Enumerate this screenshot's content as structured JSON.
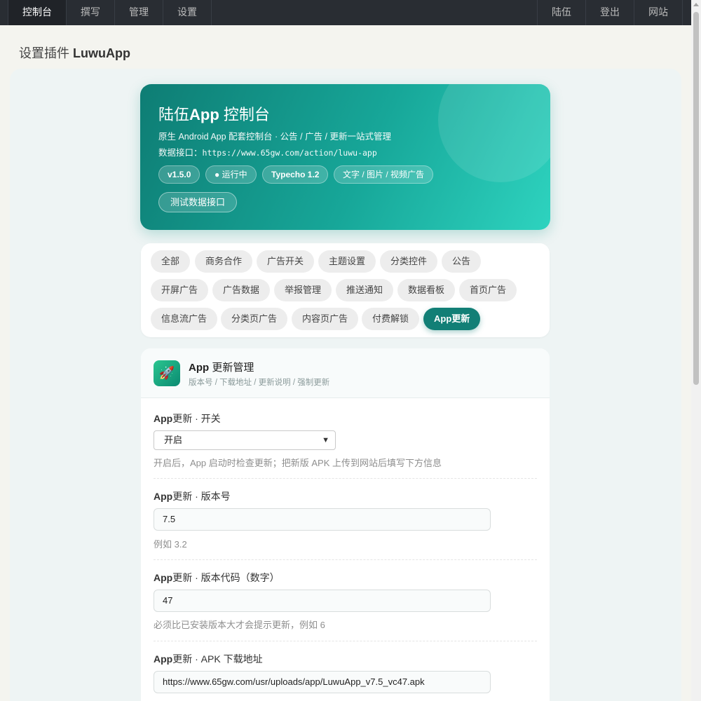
{
  "nav": {
    "left": [
      "控制台",
      "撰写",
      "管理",
      "设置"
    ],
    "right": [
      "陆伍",
      "登出",
      "网站"
    ]
  },
  "page_title_prefix": "设置插件",
  "page_title_name": "LuwuApp",
  "hero": {
    "title_a": "陆伍",
    "title_b": "App",
    "title_c": " 控制台",
    "subtitle": "原生 Android App 配套控制台 · 公告 / 广告 / 更新一站式管理",
    "api_label": "数据接口：",
    "api_url": "https://www.65gw.com/action/luwu-app",
    "badges": [
      "v1.5.0",
      "● 运行中",
      "Typecho 1.2",
      "文字 / 图片 / 视频广告"
    ],
    "test_button": "测试数据接口"
  },
  "filters": [
    "全部",
    "商务合作",
    "广告开关",
    "主题设置",
    "分类控件",
    "公告",
    "开屏广告",
    "广告数据",
    "举报管理",
    "推送通知",
    "数据看板",
    "首页广告",
    "信息流广告",
    "分类页广告",
    "内容页广告",
    "付费解锁",
    "App更新"
  ],
  "active_filter": "App更新",
  "card": {
    "icon": "rocket-icon",
    "title_a": "App",
    "title_b": " 更新管理",
    "subtitle": "版本号 / 下载地址 / 更新说明 / 强制更新"
  },
  "fields": [
    {
      "label_a": "App",
      "label_b": "更新 · 开关",
      "value": "开启",
      "hint": "开启后，App 启动时检查更新；把新版 APK 上传到网站后填写下方信息"
    },
    {
      "label_a": "App",
      "label_b": "更新 · 版本号",
      "value": "7.5",
      "hint": "例如 3.2"
    },
    {
      "label_a": "App",
      "label_b": "更新 · 版本代码（数字）",
      "value": "47",
      "hint": "必须比已安装版本大才会提示更新，例如 6"
    },
    {
      "label_a": "App",
      "label_b": "更新 · APK 下载地址",
      "value": "https://www.65gw.com/usr/uploads/app/LuwuApp_v7.5_vc47.apk",
      "hint": ""
    }
  ],
  "colors": {
    "nav_bg": "#292d33",
    "accent": "#127f76",
    "hero_start": "#0e7d74",
    "hero_end": "#2ed3bf"
  }
}
